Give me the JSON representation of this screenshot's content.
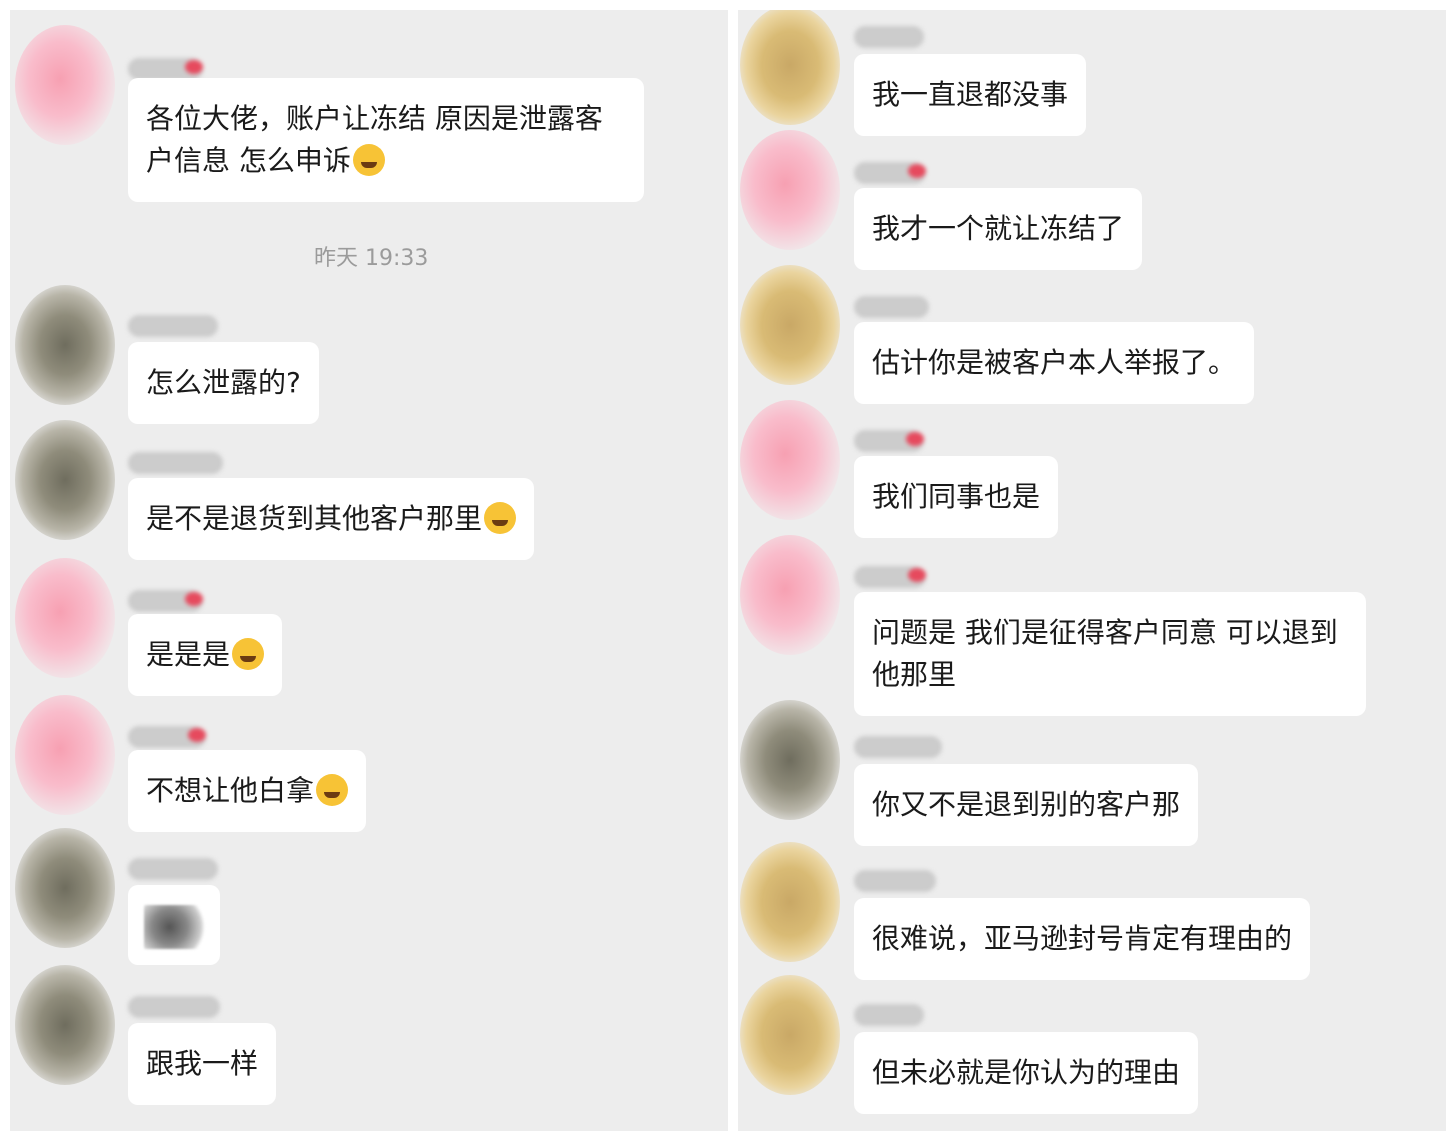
{
  "left_panel": {
    "messages": [
      {
        "text": "各位大佬，账户让冻结 原因是泄露客户信息 怎么申诉",
        "emoji": "crying-laughing-face-icon"
      },
      {
        "text": "怎么泄露的?"
      },
      {
        "text": "是不是退货到其他客户那里",
        "emoji": "grinning-sweat-face-icon"
      },
      {
        "text": "是是是",
        "emoji": "crying-laughing-face-icon"
      },
      {
        "text": "不想让他白拿",
        "emoji": "tears-of-joy-face-icon"
      },
      {
        "text": "",
        "sticker": "blurred-sticker"
      },
      {
        "text": "跟我一样"
      }
    ],
    "timestamp": "昨天 19:33"
  },
  "right_panel": {
    "messages": [
      {
        "text": "我一直退都没事"
      },
      {
        "text": "我才一个就让冻结了"
      },
      {
        "text": "估计你是被客户本人举报了。"
      },
      {
        "text": "我们同事也是"
      },
      {
        "text": "问题是 我们是征得客户同意 可以退到他那里"
      },
      {
        "text": "你又不是退到别的客户那"
      },
      {
        "text": "很难说，亚马逊封号肯定有理由的"
      },
      {
        "text": "但未必就是你认为的理由"
      }
    ]
  },
  "colors": {
    "chat_background": "#ededed",
    "bubble": "#ffffff",
    "text": "#1a1a1a",
    "timestamp": "#9b9b9b"
  }
}
